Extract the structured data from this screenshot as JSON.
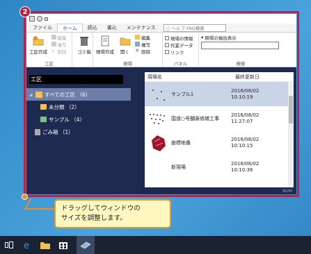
{
  "step_badge": "2",
  "window": {
    "title_icons": [
      "app-icon",
      "undo-icon",
      "dropdown-icon"
    ],
    "tabs": [
      "ファイル",
      "ホーム",
      "読込",
      "書込",
      "メンテナンス"
    ],
    "active_tab": "ホーム",
    "help_search_placeholder": "ヘルプ-FAQ検索",
    "ribbon": {
      "group_koku": {
        "label": "工区",
        "create_label": "工区作成",
        "edit_label": "編集",
        "copy_label": "複写",
        "delete_label": "削除"
      },
      "trash_label": "ゴミ箱",
      "group_genba": {
        "label": "現場",
        "create_label": "現場作成",
        "open_label": "開く",
        "edit_label": "編集",
        "copy_label": "複写",
        "delete_label": "削除"
      },
      "group_panel": {
        "label": "パネル",
        "items": [
          "現場の情報",
          "作業データ",
          "リンク"
        ]
      },
      "group_search": {
        "label": "検索",
        "extract_label": "現場の抽出表示"
      }
    },
    "tree": {
      "header": "工区",
      "nodes": [
        {
          "label": "すべての工区 （6）"
        },
        {
          "label": "未分類 （2）"
        },
        {
          "label": "サンプル （4）"
        },
        {
          "label": "ごみ箱 （1）"
        }
      ]
    },
    "files": {
      "col_name": "現場名",
      "col_date": "最終更新日",
      "rows": [
        {
          "name": "サンプル1",
          "date": "2016/08/02",
          "time": "10:10:19"
        },
        {
          "name": "国道○号舗装修繕工事",
          "date": "2016/08/02",
          "time": "11:27:07"
        },
        {
          "name": "座標地番",
          "date": "2016/08/02",
          "time": "10:10:15"
        },
        {
          "name": "新現場",
          "date": "2016/08/02",
          "time": "10:10:36"
        }
      ]
    },
    "status_right": "NUM"
  },
  "callout": {
    "line1": "ドラッグしてウィンドウの",
    "line2": "サイズを調整します。"
  },
  "colors": {
    "frame": "#b5224a",
    "callout_bg": "#fff7bf",
    "callout_border": "#e59a2e",
    "handle": "#f08a22"
  },
  "taskbar": {
    "icons": [
      "task-view-icon",
      "edge-icon",
      "file-explorer-icon",
      "store-icon",
      "app-icon"
    ]
  }
}
